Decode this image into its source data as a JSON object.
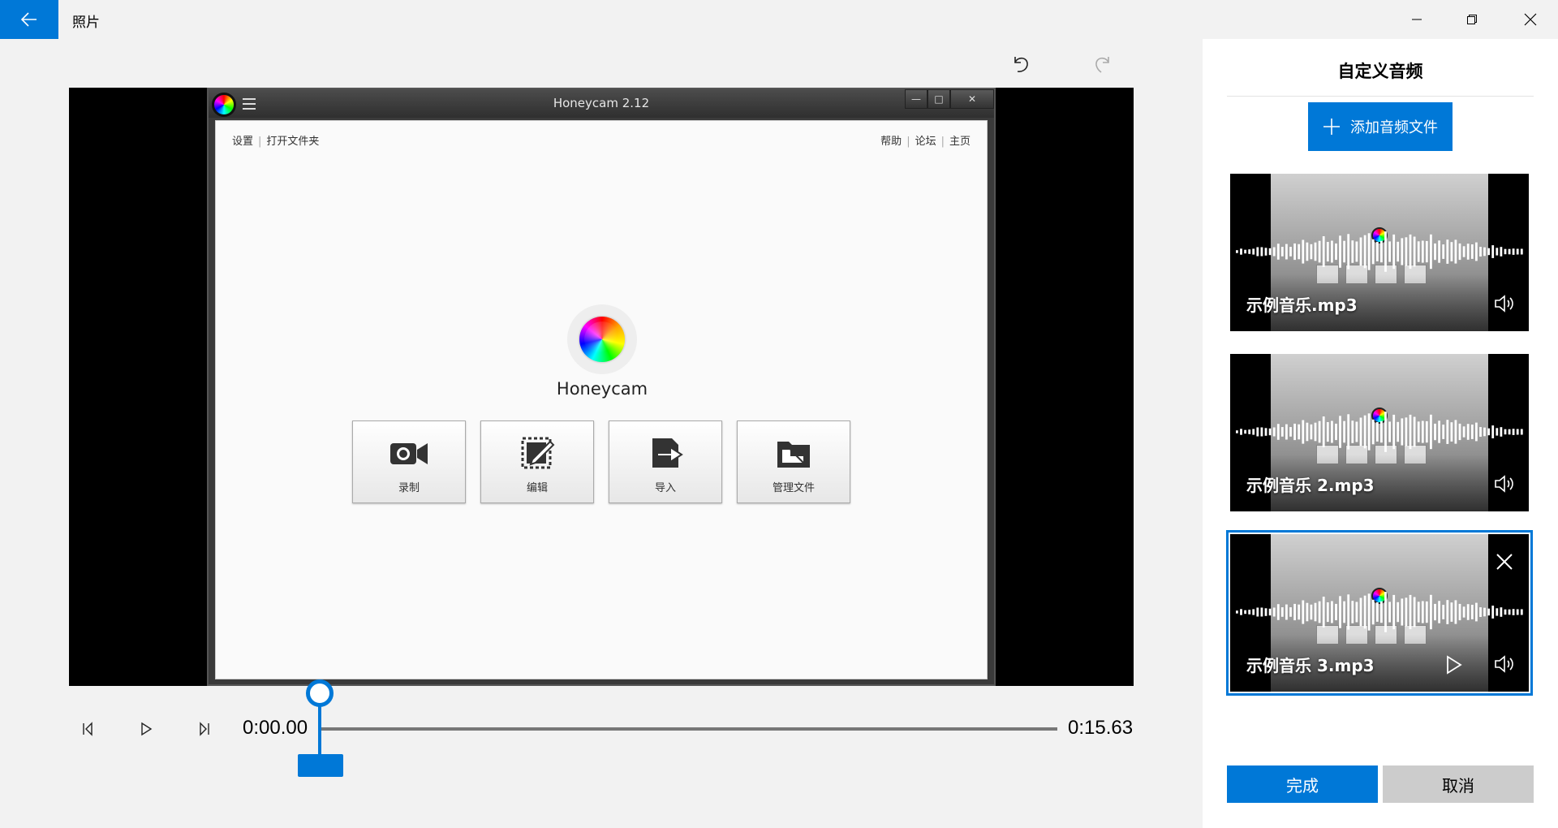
{
  "titlebar": {
    "app_title": "照片"
  },
  "player": {
    "current_time": "0:00.00",
    "total_time": "0:15.63",
    "progress": 0
  },
  "video_content": {
    "window_title": "Honeycam 2.12",
    "menu_left": [
      "设置",
      "打开文件夹"
    ],
    "menu_right": [
      "帮助",
      "论坛",
      "主页"
    ],
    "app_name": "Honeycam",
    "tiles": [
      {
        "label": "录制",
        "icon": "camera-icon"
      },
      {
        "label": "编辑",
        "icon": "edit-icon"
      },
      {
        "label": "导入",
        "icon": "import-icon"
      },
      {
        "label": "管理文件",
        "icon": "folder-icon"
      }
    ]
  },
  "panel": {
    "title": "自定义音频",
    "add_label": "添加音频文件",
    "cards": [
      {
        "name": "示例音乐.mp3",
        "selected": false
      },
      {
        "name": "示例音乐 2.mp3",
        "selected": false
      },
      {
        "name": "示例音乐 3.mp3",
        "selected": true
      }
    ],
    "done_label": "完成",
    "cancel_label": "取消"
  },
  "colors": {
    "accent": "#0078d7",
    "panel_bg": "#ffffff",
    "app_bg": "#f2f2f2",
    "cancel_bg": "#cccccc"
  }
}
